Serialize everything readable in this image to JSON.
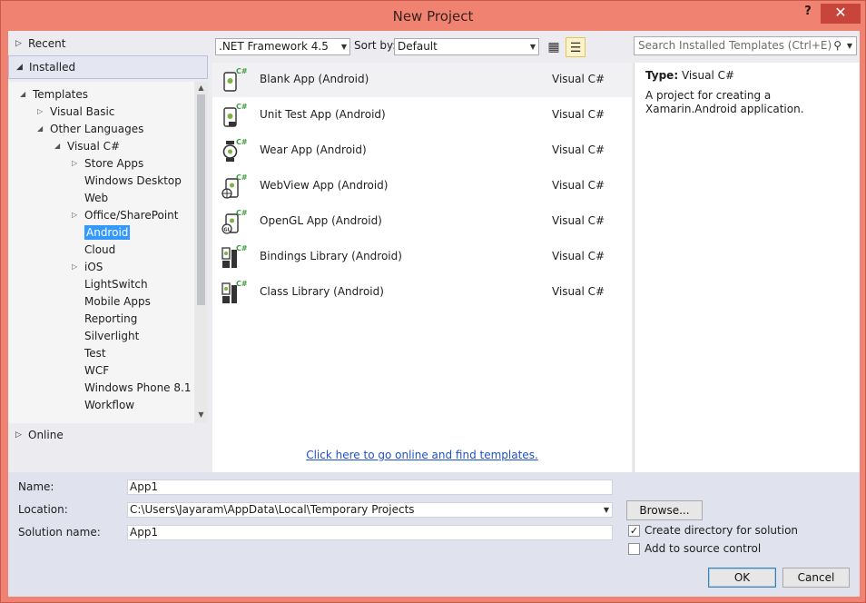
{
  "window": {
    "title": "New Project",
    "help_label": "?",
    "close_label": "✕"
  },
  "nav": {
    "recent": "Recent",
    "installed": "Installed",
    "online": "Online"
  },
  "tree": {
    "templates": "Templates",
    "visual_basic": "Visual Basic",
    "other_languages": "Other Languages",
    "visual_csharp": "Visual C#",
    "items": [
      "Store Apps",
      "Windows Desktop",
      "Web",
      "Office/SharePoint",
      "Android",
      "Cloud",
      "iOS",
      "LightSwitch",
      "Mobile Apps",
      "Reporting",
      "Silverlight",
      "Test",
      "WCF",
      "Windows Phone 8.1",
      "Workflow"
    ],
    "selected": "Android"
  },
  "toolbar": {
    "framework": ".NET Framework 4.5",
    "sort_label": "Sort by:",
    "sort_value": "Default",
    "search_placeholder": "Search Installed Templates (Ctrl+E)"
  },
  "templates": [
    {
      "name": "Blank App (Android)",
      "lang": "Visual C#",
      "icon": "android-blank-app-icon"
    },
    {
      "name": "Unit Test App (Android)",
      "lang": "Visual C#",
      "icon": "android-unit-test-icon"
    },
    {
      "name": "Wear App (Android)",
      "lang": "Visual C#",
      "icon": "android-wear-icon"
    },
    {
      "name": "WebView App (Android)",
      "lang": "Visual C#",
      "icon": "android-webview-icon"
    },
    {
      "name": "OpenGL App (Android)",
      "lang": "Visual C#",
      "icon": "android-opengl-icon"
    },
    {
      "name": "Bindings Library (Android)",
      "lang": "Visual C#",
      "icon": "android-bindings-library-icon"
    },
    {
      "name": "Class Library (Android)",
      "lang": "Visual C#",
      "icon": "android-class-library-icon"
    }
  ],
  "online_link": "Click here to go online and find templates.",
  "description": {
    "type_label": "Type:",
    "type_value": "Visual C#",
    "text": "A project for creating a Xamarin.Android application."
  },
  "form": {
    "name_label": "Name:",
    "name_value": "App1",
    "location_label": "Location:",
    "location_value": "C:\\Users\\Jayaram\\AppData\\Local\\Temporary Projects",
    "solution_label": "Solution name:",
    "solution_value": "App1",
    "browse_label": "Browse...",
    "create_dir_label": "Create directory for solution",
    "create_dir_checked": true,
    "source_control_label": "Add to source control",
    "source_control_checked": false,
    "ok_label": "OK",
    "cancel_label": "Cancel"
  },
  "colors": {
    "accent": "#3399ff",
    "link": "#1e50c8",
    "titlebar": "#f08272",
    "close": "#c7453a"
  }
}
